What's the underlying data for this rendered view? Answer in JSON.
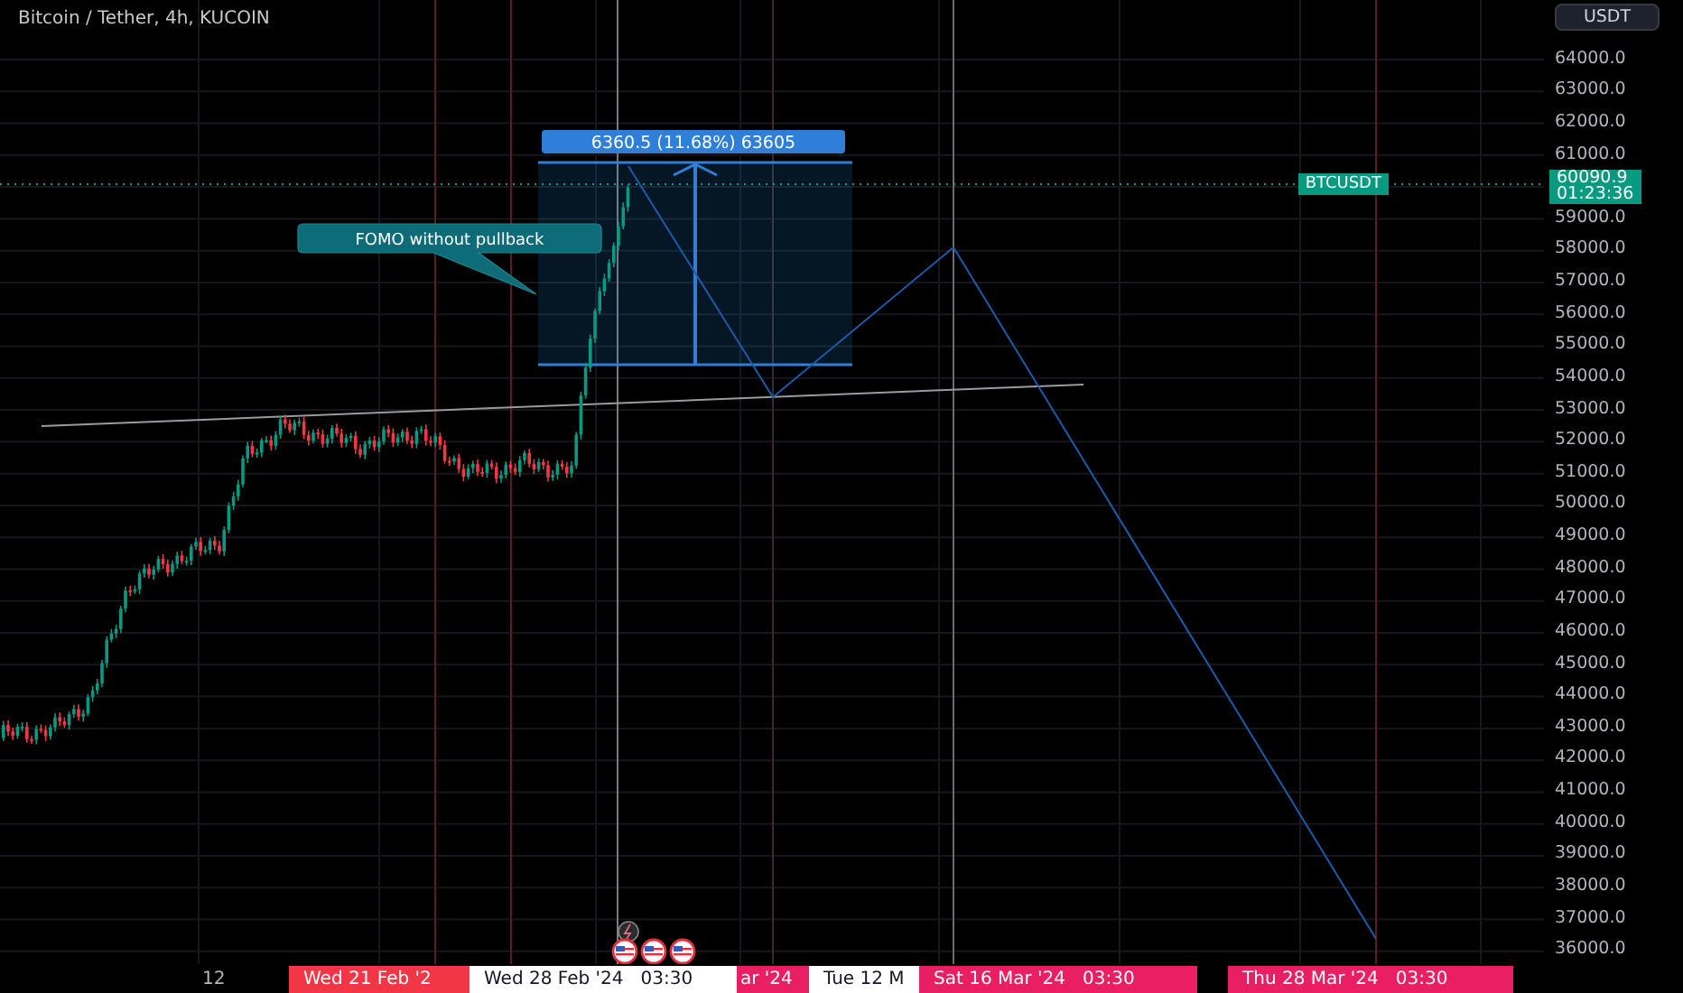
{
  "header": {
    "title": "Bitcoin / Tether, 4h, KUCOIN"
  },
  "currency_button": "USDT",
  "annotations": {
    "callout": "FOMO without pullback",
    "measurement": "6360.5 (11.68%) 63605"
  },
  "price_axis": {
    "rows": [
      {
        "kind": "tick",
        "text": "64000.0"
      },
      {
        "kind": "tick",
        "text": "63000.0"
      },
      {
        "kind": "tick",
        "text": "62000.0"
      },
      {
        "kind": "tick",
        "text": "61000.0"
      },
      {
        "kind": "last_price",
        "symbol": "BTCUSDT",
        "text": "60090.9",
        "countdown": "01:23:36"
      },
      {
        "kind": "tick",
        "text": "59000.0"
      },
      {
        "kind": "tick",
        "text": "58000.0"
      },
      {
        "kind": "tick",
        "text": "57000.0"
      },
      {
        "kind": "tick",
        "text": "56000.0"
      },
      {
        "kind": "tick",
        "text": "55000.0"
      },
      {
        "kind": "tick",
        "text": "54000.0"
      },
      {
        "kind": "tick",
        "text": "53000.0"
      },
      {
        "kind": "tick",
        "text": "52000.0"
      },
      {
        "kind": "tick",
        "text": "51000.0"
      },
      {
        "kind": "tick",
        "text": "50000.0"
      },
      {
        "kind": "tick",
        "text": "49000.0"
      },
      {
        "kind": "tick",
        "text": "48000.0"
      },
      {
        "kind": "tick",
        "text": "47000.0"
      },
      {
        "kind": "tick",
        "text": "46000.0"
      },
      {
        "kind": "tick",
        "text": "45000.0"
      },
      {
        "kind": "tick",
        "text": "44000.0"
      },
      {
        "kind": "tick",
        "text": "43000.0"
      },
      {
        "kind": "tick",
        "text": "42000.0"
      },
      {
        "kind": "tick",
        "text": "41000.0"
      },
      {
        "kind": "tick",
        "text": "40000.0"
      },
      {
        "kind": "tick",
        "text": "39000.0"
      },
      {
        "kind": "tick",
        "text": "38000.0"
      },
      {
        "kind": "tick",
        "text": "37000.0"
      },
      {
        "kind": "tick",
        "text": "36000.0"
      }
    ]
  },
  "time_axis": {
    "labels": [
      {
        "kind": "tick",
        "text": "12"
      },
      {
        "kind": "marker",
        "text": "Wed 21 Feb '2",
        "color": "#f23645"
      },
      {
        "kind": "cursor",
        "text": "Wed 28 Feb '24   03:30"
      },
      {
        "kind": "marker",
        "text": "ar '24",
        "color": "#e91e63"
      },
      {
        "kind": "cursor",
        "text": "Tue 12 M"
      },
      {
        "kind": "marker",
        "text": "Sat 16 Mar '24   03:30",
        "color": "#e91e63"
      },
      {
        "kind": "marker",
        "text": "Thu 28 Mar '24   03:30",
        "color": "#e91e63"
      }
    ]
  }
}
